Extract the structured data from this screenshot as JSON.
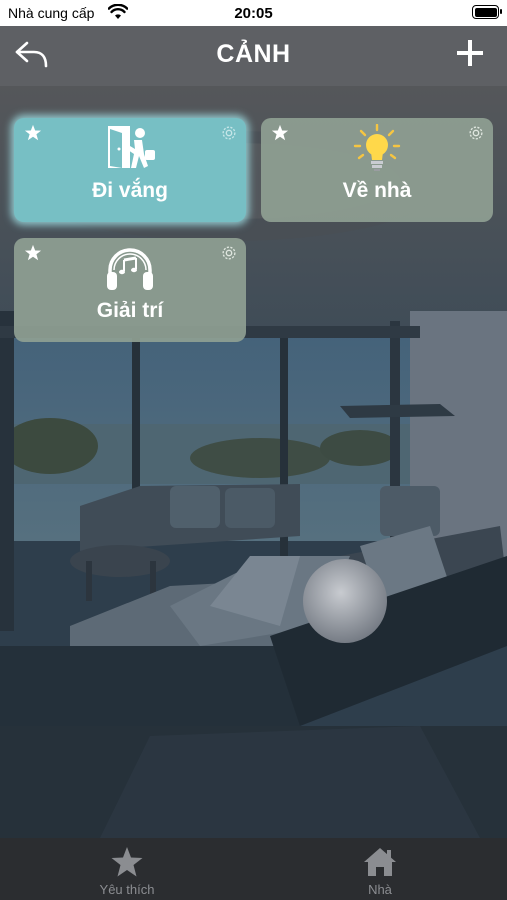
{
  "status_bar": {
    "carrier": "Nhà cung cấp",
    "time": "20:05"
  },
  "nav": {
    "title": "CẢNH",
    "back_icon": "back-arrow-icon",
    "add_icon": "plus-icon"
  },
  "scenes": [
    {
      "label": "Đi vắng",
      "icon": "leave-home-icon",
      "active": true,
      "favorite": true
    },
    {
      "label": "Về nhà",
      "icon": "light-bulb-icon",
      "active": false,
      "favorite": true
    },
    {
      "label": "Giải trí",
      "icon": "headphones-music-icon",
      "active": false,
      "favorite": true
    }
  ],
  "tabs": [
    {
      "label": "Yêu thích",
      "icon": "star-icon"
    },
    {
      "label": "Nhà",
      "icon": "home-icon"
    }
  ],
  "colors": {
    "nav_bar": "#5e6064",
    "active_card": "#77bfc4",
    "card": "#8fa092",
    "tab_bar": "#2b2d30",
    "tab_label": "#8b8d91"
  }
}
